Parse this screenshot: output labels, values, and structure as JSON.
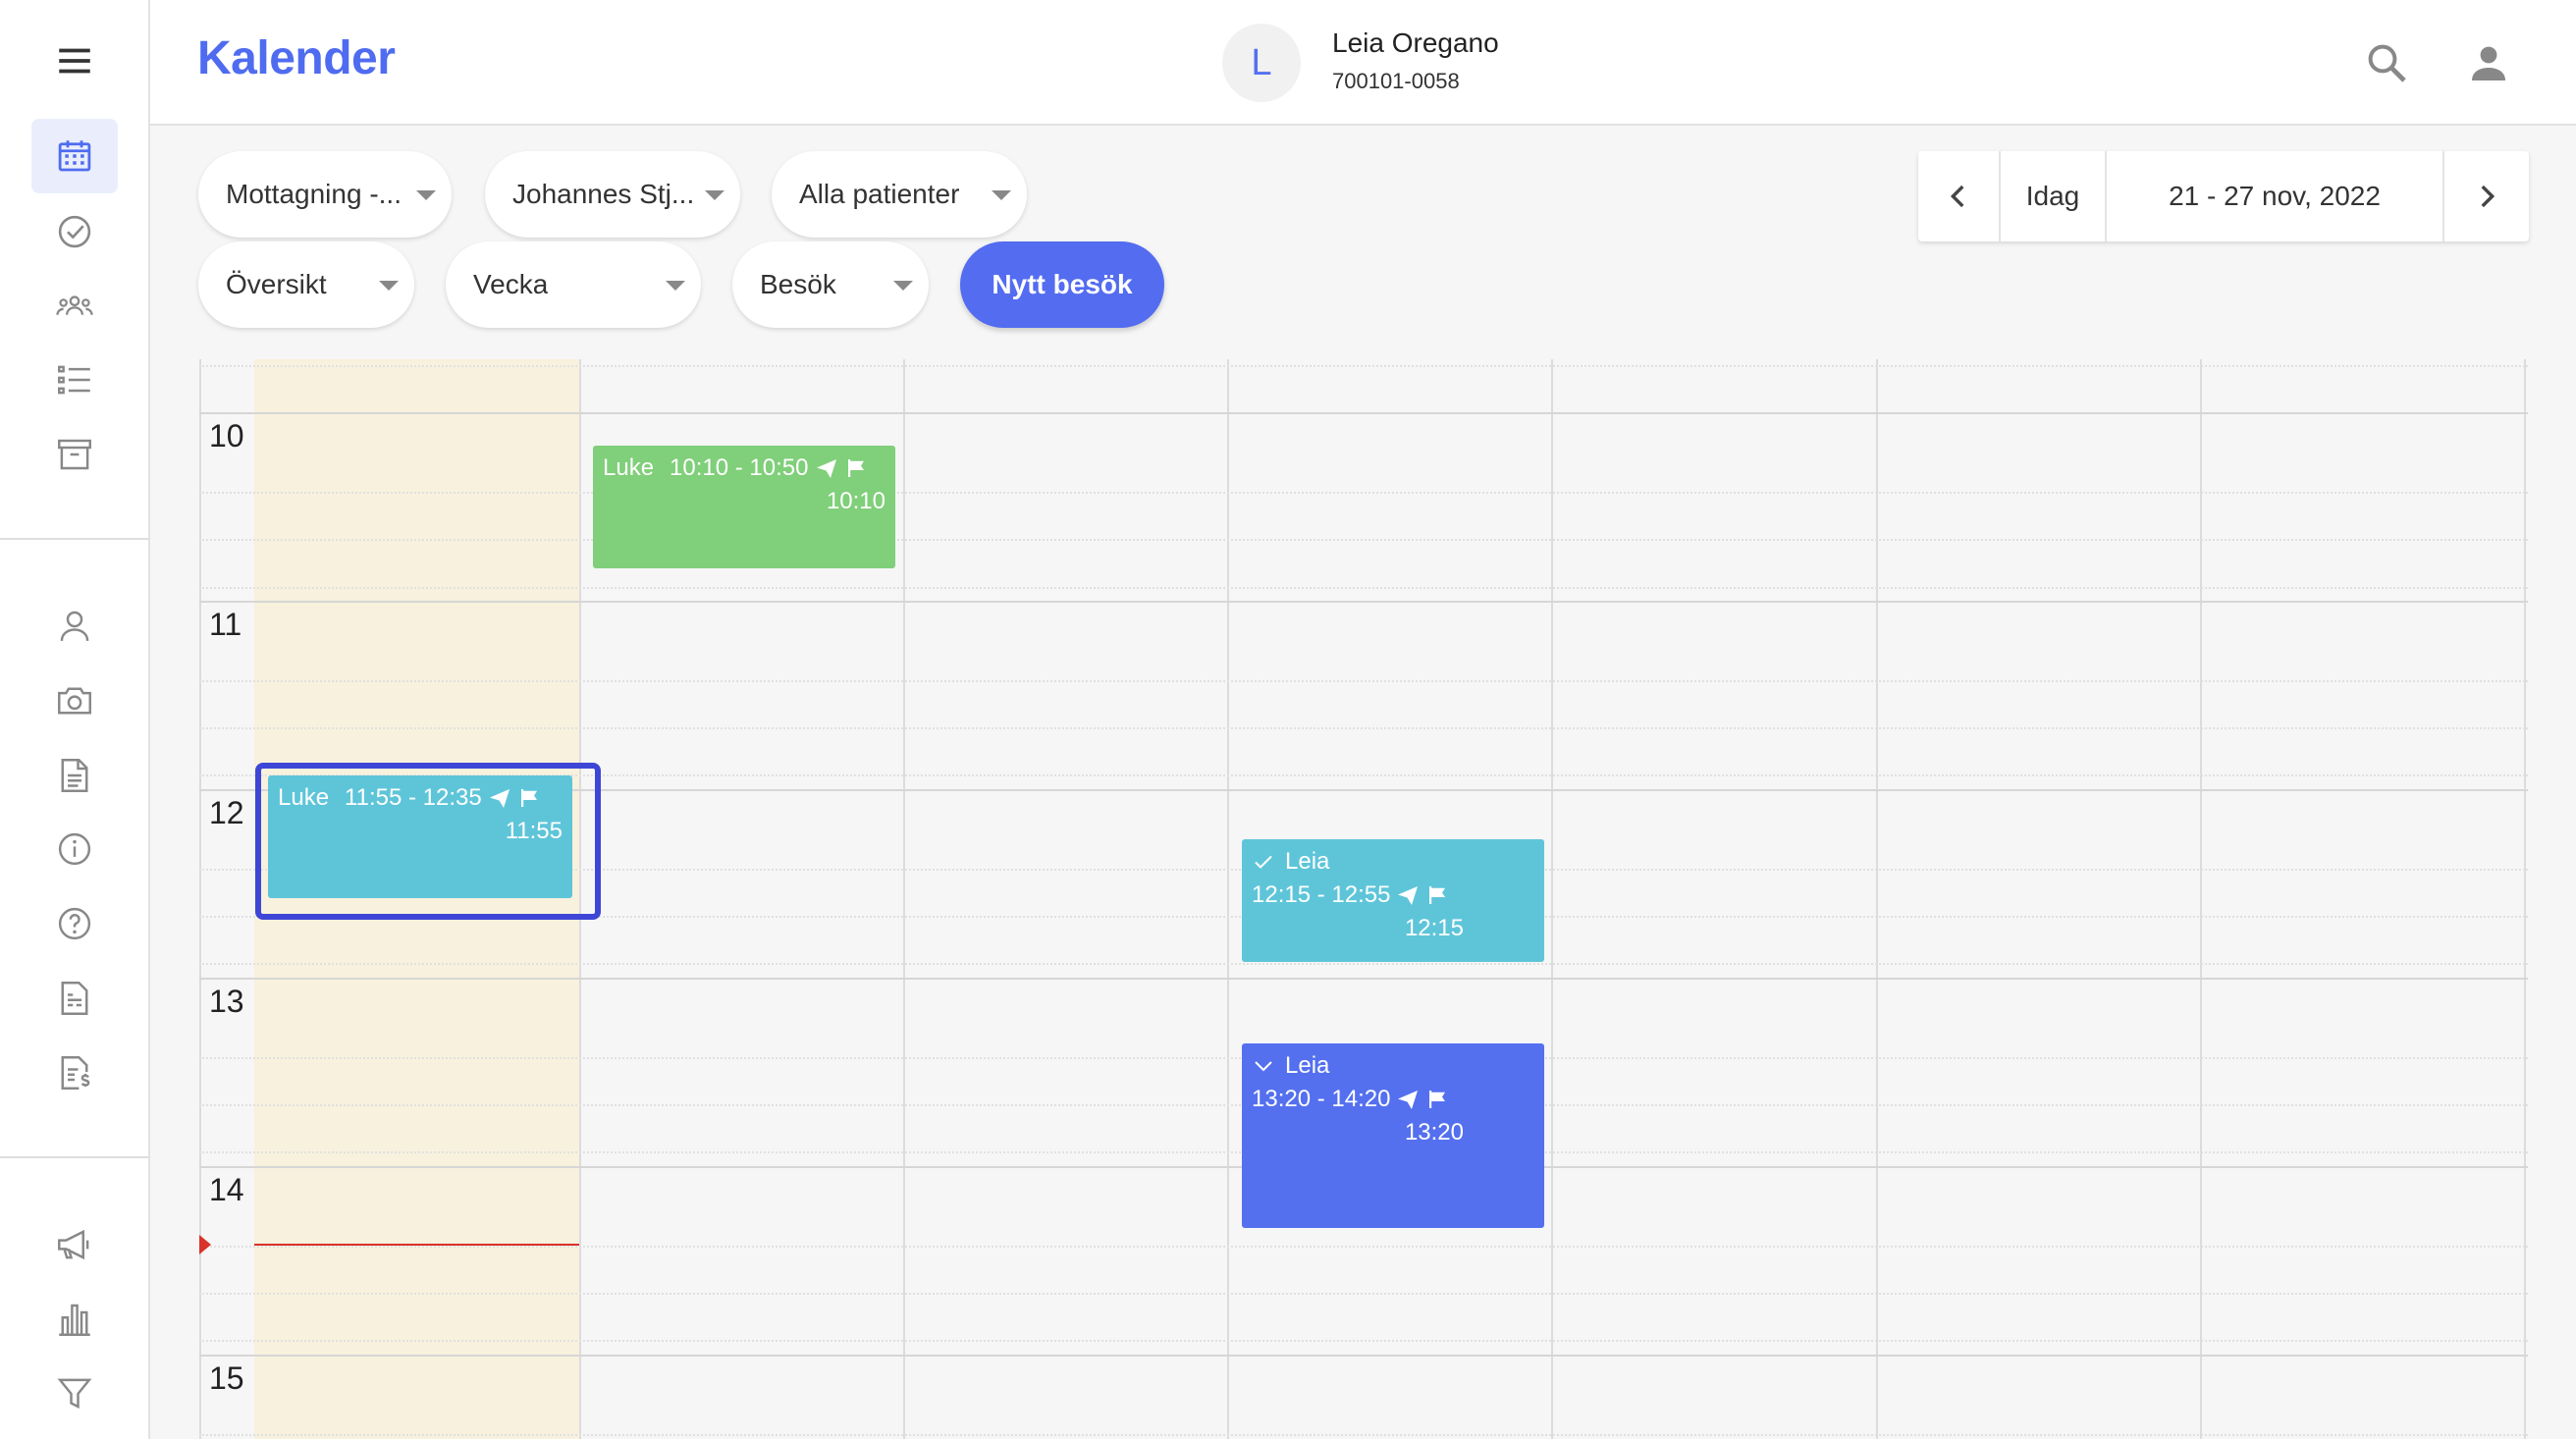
{
  "app": {
    "title": "Kalender"
  },
  "patient": {
    "initial": "L",
    "name": "Leia Oregano",
    "id": "700101-0058"
  },
  "sidebar": {
    "items": [
      {
        "icon": "menu-icon"
      },
      {
        "icon": "calendar-icon",
        "active": true
      },
      {
        "icon": "check-circle-icon"
      },
      {
        "icon": "group-icon"
      },
      {
        "icon": "list-icon"
      },
      {
        "icon": "archive-icon"
      },
      {
        "icon": "person-icon"
      },
      {
        "icon": "camera-icon"
      },
      {
        "icon": "document-icon"
      },
      {
        "icon": "info-icon"
      },
      {
        "icon": "help-icon"
      },
      {
        "icon": "report-icon"
      },
      {
        "icon": "invoice-icon"
      },
      {
        "icon": "megaphone-icon"
      },
      {
        "icon": "bar-chart-icon"
      },
      {
        "icon": "filter-icon"
      }
    ]
  },
  "filters": {
    "reception": "Mottagning -...",
    "practitioner": "Johannes Stj...",
    "patients": "Alla patienter",
    "overview": "Översikt",
    "period": "Vecka",
    "type": "Besök",
    "new_visit": "Nytt besök"
  },
  "date_nav": {
    "today": "Idag",
    "range": "21 - 27 nov, 2022"
  },
  "calendar": {
    "hours": [
      "10",
      "11",
      "12",
      "13",
      "14",
      "15"
    ],
    "events": [
      {
        "name": "Luke",
        "time": "10:10 - 10:50",
        "start": "10:10",
        "color": "#80cf7a",
        "day": 1,
        "selected": false
      },
      {
        "name": "Luke",
        "time": "11:55 - 12:35",
        "start": "11:55",
        "color": "#5ec5d9",
        "day": 0,
        "selected": true
      },
      {
        "name": "Leia",
        "time": "12:15 - 12:55",
        "start": "12:15",
        "color": "#5ec5d9",
        "day": 3,
        "status_icon": "check-icon"
      },
      {
        "name": "Leia",
        "time": "13:20 - 14:20",
        "start": "13:20",
        "color": "#5470ef",
        "day": 3,
        "status_icon": "chevron-down-icon"
      }
    ]
  },
  "colors": {
    "accent": "#536cf0",
    "today_bg": "#f7f1dd",
    "now_line": "#d8332b"
  }
}
